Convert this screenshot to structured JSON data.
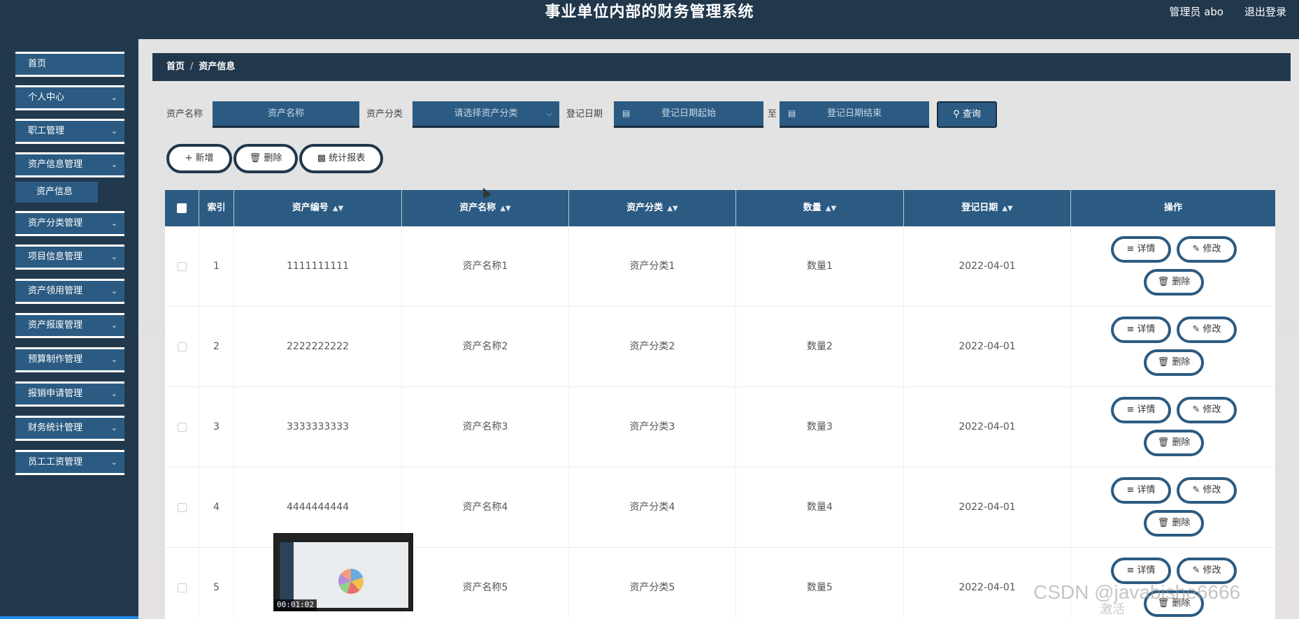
{
  "header": {
    "title": "事业单位内部的财务管理系统",
    "user": "管理员 abo",
    "logout": "退出登录"
  },
  "sidebar": {
    "items": [
      {
        "label": "首页",
        "has_arrow": false
      },
      {
        "label": "个人中心",
        "has_arrow": true
      },
      {
        "label": "职工管理",
        "has_arrow": true
      },
      {
        "label": "资产信息管理",
        "has_arrow": true
      },
      {
        "label": "资产分类管理",
        "has_arrow": true
      },
      {
        "label": "项目信息管理",
        "has_arrow": true
      },
      {
        "label": "资产领用管理",
        "has_arrow": true
      },
      {
        "label": "资产报废管理",
        "has_arrow": true
      },
      {
        "label": "预算制作管理",
        "has_arrow": true
      },
      {
        "label": "报销申请管理",
        "has_arrow": true
      },
      {
        "label": "财务统计管理",
        "has_arrow": true
      },
      {
        "label": "员工工资管理",
        "has_arrow": true
      }
    ],
    "subitem": "资产信息"
  },
  "breadcrumb": {
    "home": "首页",
    "sep": "/",
    "current": "资产信息"
  },
  "search": {
    "name_label": "资产名称",
    "name_placeholder": "资产名称",
    "category_label": "资产分类",
    "category_placeholder": "请选择资产分类",
    "date_label": "登记日期",
    "date_start_placeholder": "登记日期起始",
    "date_to": "至",
    "date_end_placeholder": "登记日期结束",
    "search_button": "查询"
  },
  "actions": {
    "add": "新增",
    "delete": "删除",
    "report": "统计报表"
  },
  "table": {
    "columns": [
      "索引",
      "资产编号",
      "资产名称",
      "资产分类",
      "数量",
      "登记日期",
      "操作"
    ],
    "rows": [
      {
        "index": "1",
        "code": "1111111111",
        "name": "资产名称1",
        "category": "资产分类1",
        "qty": "数量1",
        "date": "2022-04-01"
      },
      {
        "index": "2",
        "code": "2222222222",
        "name": "资产名称2",
        "category": "资产分类2",
        "qty": "数量2",
        "date": "2022-04-01"
      },
      {
        "index": "3",
        "code": "3333333333",
        "name": "资产名称3",
        "category": "资产分类3",
        "qty": "数量3",
        "date": "2022-04-01"
      },
      {
        "index": "4",
        "code": "4444444444",
        "name": "资产名称4",
        "category": "资产分类4",
        "qty": "数量4",
        "date": "2022-04-01"
      },
      {
        "index": "5",
        "code": "",
        "name": "资产名称5",
        "category": "资产分类5",
        "qty": "数量5",
        "date": "2022-04-01"
      }
    ],
    "op_detail": "详情",
    "op_edit": "修改",
    "op_delete": "删除"
  },
  "overlay": {
    "video_time": "00:01:02",
    "watermark": "CSDN @javabishe6666",
    "watermark2": "激活"
  },
  "icons": {
    "sort": "sort-icon",
    "calendar": "calendar-icon",
    "search": "search-icon",
    "plus": "plus-icon",
    "trash": "trash-icon",
    "chart": "bar-chart-icon",
    "doc": "document-icon",
    "pen": "pen-icon",
    "chevron": "chevron-down-icon"
  },
  "colors": {
    "header_bg": "#21374b",
    "accent": "#2b5b82",
    "sidebar_bg": "#22384c"
  }
}
